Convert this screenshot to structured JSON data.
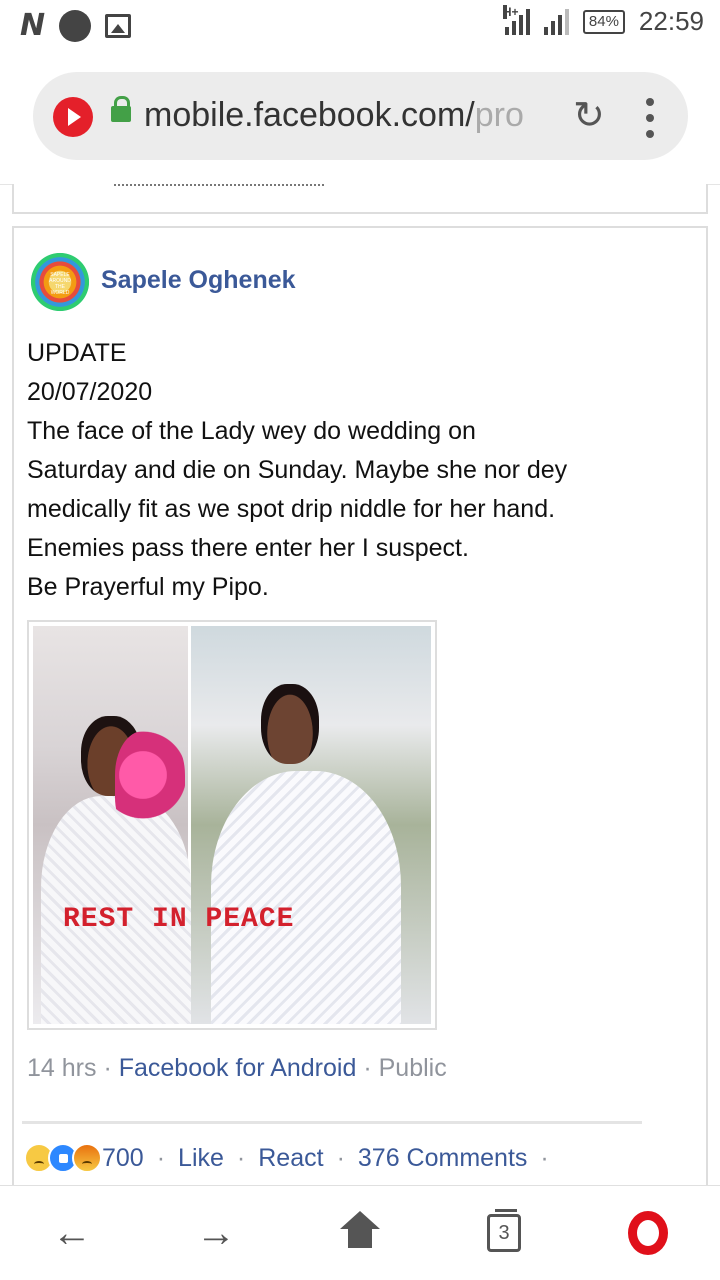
{
  "status_bar": {
    "network_icon": "n-icon",
    "battery": "84%",
    "time": "22:59",
    "signal_label": "H+"
  },
  "browser": {
    "url_host": "mobile.facebook.com/",
    "url_path": "pro",
    "reload_icon": "reload-icon",
    "menu_icon": "more-vert-icon"
  },
  "post": {
    "author": "Sapele Oghenek",
    "avatar_text": "SAPELE AROUND THE WORLD",
    "lines": [
      "UPDATE",
      "20/07/2020",
      "The  face  of  the  Lady  wey  do  wedding  on",
      "Saturday  and  die  on  Sunday.  Maybe  she  nor  dey",
      "medically  fit  as  we  spot  drip  niddle  for  her  hand.",
      "Enemies  pass  there  enter  her  I  suspect.",
      "Be  Prayerful  my  Pipo."
    ],
    "image_caption": "REST IN PEACE",
    "meta": {
      "time": "14 hrs",
      "source": "Facebook  for  Android",
      "privacy": "Public",
      "separator": "·"
    },
    "reactions": {
      "count": "700",
      "like": "Like",
      "react": "React",
      "comments": "376  Comments",
      "separator": "·"
    }
  },
  "nav": {
    "tab_count": "3"
  }
}
